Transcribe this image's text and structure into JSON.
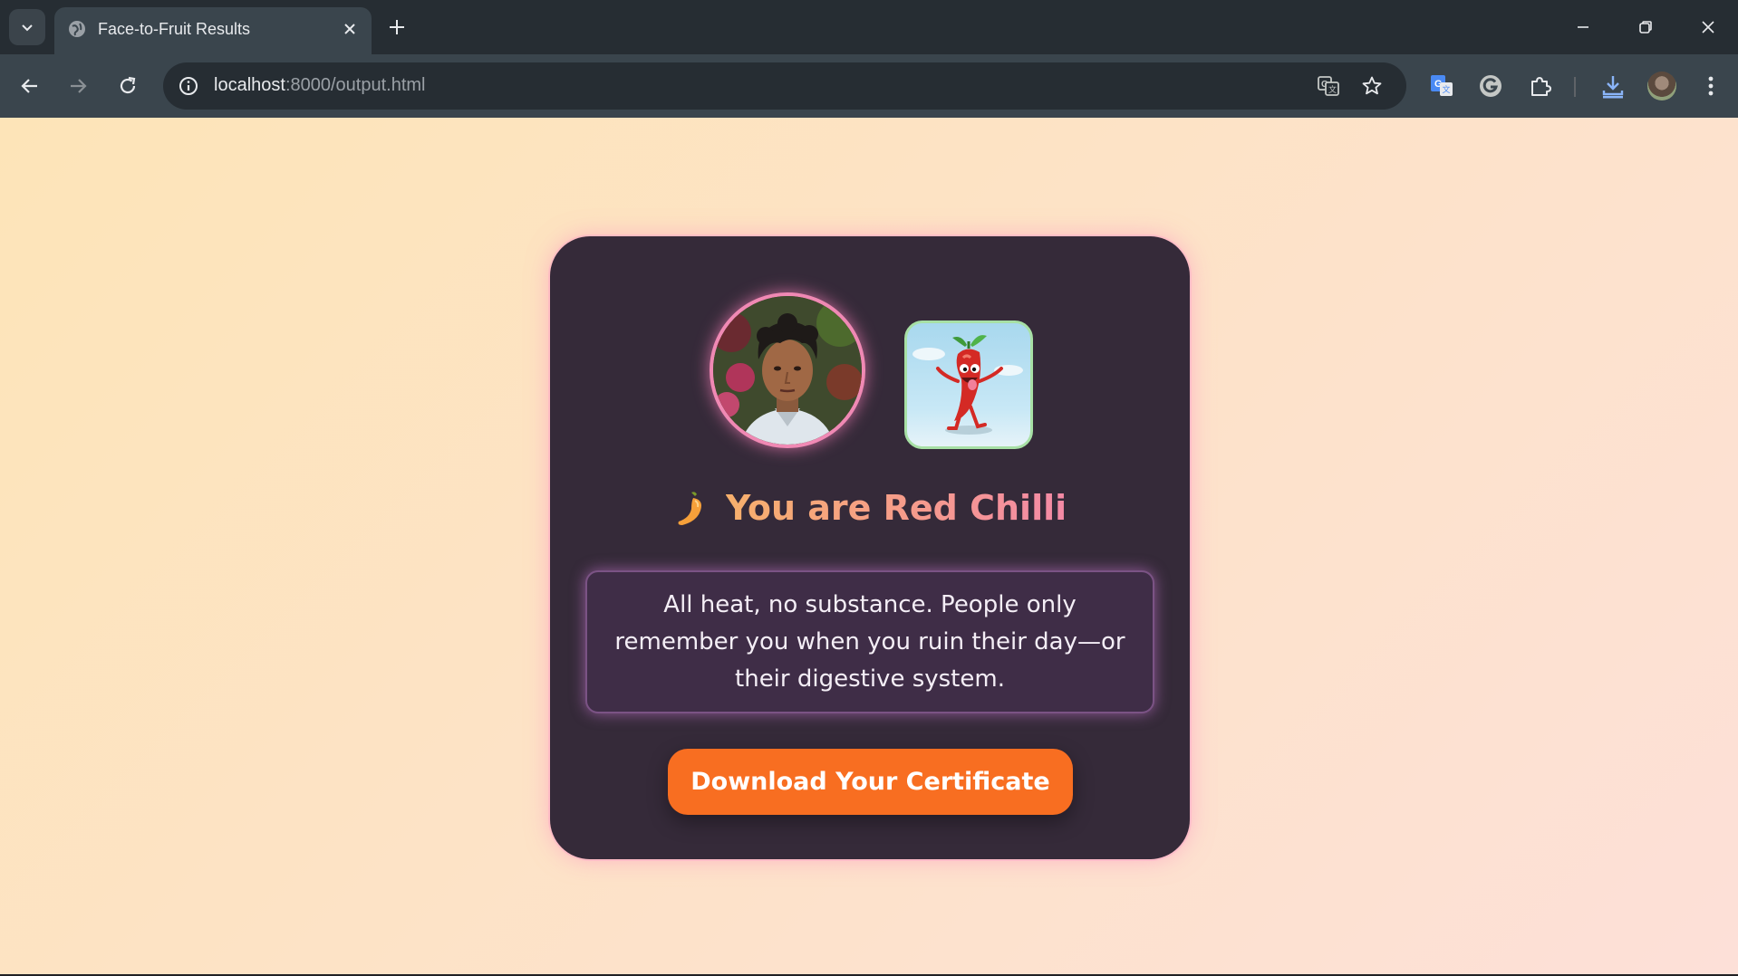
{
  "browser": {
    "tab": {
      "title": "Face-to-Fruit Results",
      "favicon": "globe-icon"
    },
    "address_bar": {
      "host": "localhost",
      "rest": ":8000/output.html"
    },
    "icons": [
      "tab-search-icon",
      "close-icon",
      "plus-icon",
      "minimize-icon",
      "restore-icon",
      "back-arrow-icon",
      "forward-arrow-icon",
      "reload-icon",
      "info-icon",
      "translate-icon",
      "star-icon",
      "google-translate-icon",
      "grammarly-icon",
      "puzzle-icon",
      "download-icon",
      "profile-avatar",
      "kebab-menu-icon"
    ]
  },
  "theme": {
    "page_gradient": [
      "#fde4b8",
      "#fde0d8"
    ],
    "card_bg": "#352a39",
    "accent_orange": "#f86e21",
    "headline_gradient": [
      "#f7b06c",
      "#f48aa6"
    ],
    "photo_border": "#f089b4",
    "fruit_border": "#a7e0a5"
  },
  "result": {
    "headline": "You are Red Chilli",
    "emoji": "hot-pepper",
    "roast": "All heat, no substance. People only remember you when you ruin their day—or their digestive system.",
    "button_label": "Download Your Certificate",
    "fruit_image": "red-chilli-cartoon",
    "user_photo": "user-face-photo"
  }
}
